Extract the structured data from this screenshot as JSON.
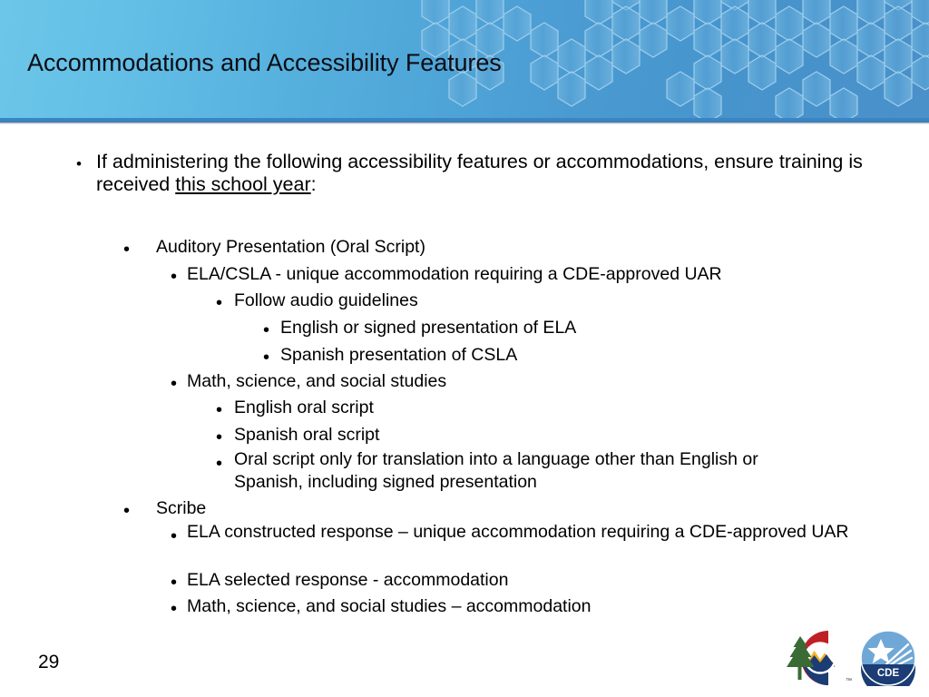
{
  "slide": {
    "title": "Accommodations and Accessibility Features",
    "page_number": "29"
  },
  "theme": {
    "header_gradient_start": "#6cc6e9",
    "header_gradient_end": "#4a90c9",
    "header_rule": "#3c86c4",
    "hexagon_stroke": "#8cc3e8",
    "hexagon_fill": "#5aa3d4",
    "body_background": "#ffffff",
    "text_color": "#000000",
    "title_color": "#0d0d14"
  },
  "body": {
    "intro": {
      "bullet": "•",
      "text_before": "If administering the following accessibility features or accommodations, ensure training is received ",
      "text_underlined": "this school year",
      "text_after": ":"
    },
    "items": [
      {
        "level": 2,
        "bullet": "•",
        "text": "Auditory Presentation (Oral Script)"
      },
      {
        "level": 3,
        "bullet": "•",
        "text": "ELA/CSLA - unique accommodation requiring a CDE-approved UAR"
      },
      {
        "level": 4,
        "bullet": "•",
        "text": "Follow audio guidelines"
      },
      {
        "level": 5,
        "bullet": "•",
        "text": "English or signed presentation of ELA"
      },
      {
        "level": 5,
        "bullet": "•",
        "text": "Spanish presentation of CSLA"
      },
      {
        "level": 3,
        "bullet": "•",
        "text": "Math, science, and social studies"
      },
      {
        "level": 4,
        "bullet": "•",
        "text": "English oral script"
      },
      {
        "level": 4,
        "bullet": "•",
        "text": "Spanish oral script"
      },
      {
        "level": 4,
        "bullet": "•",
        "text": "Oral script only for translation into a language other than English or Spanish, including signed presentation"
      },
      {
        "level": 2,
        "bullet": "•",
        "text": "Scribe"
      },
      {
        "level": 3,
        "bullet": "•",
        "text": "ELA constructed response – unique accommodation requiring a CDE-approved UAR"
      },
      {
        "level": 3,
        "bullet": "•",
        "text": "ELA selected response - accommodation"
      },
      {
        "level": 3,
        "bullet": "•",
        "text": "Math, science, and social studies – accommodation"
      }
    ]
  },
  "logos": {
    "colorado": {
      "name": "colorado-state-logo",
      "trademark": "™"
    },
    "cde": {
      "name": "cde-logo",
      "label": "CDE"
    }
  }
}
